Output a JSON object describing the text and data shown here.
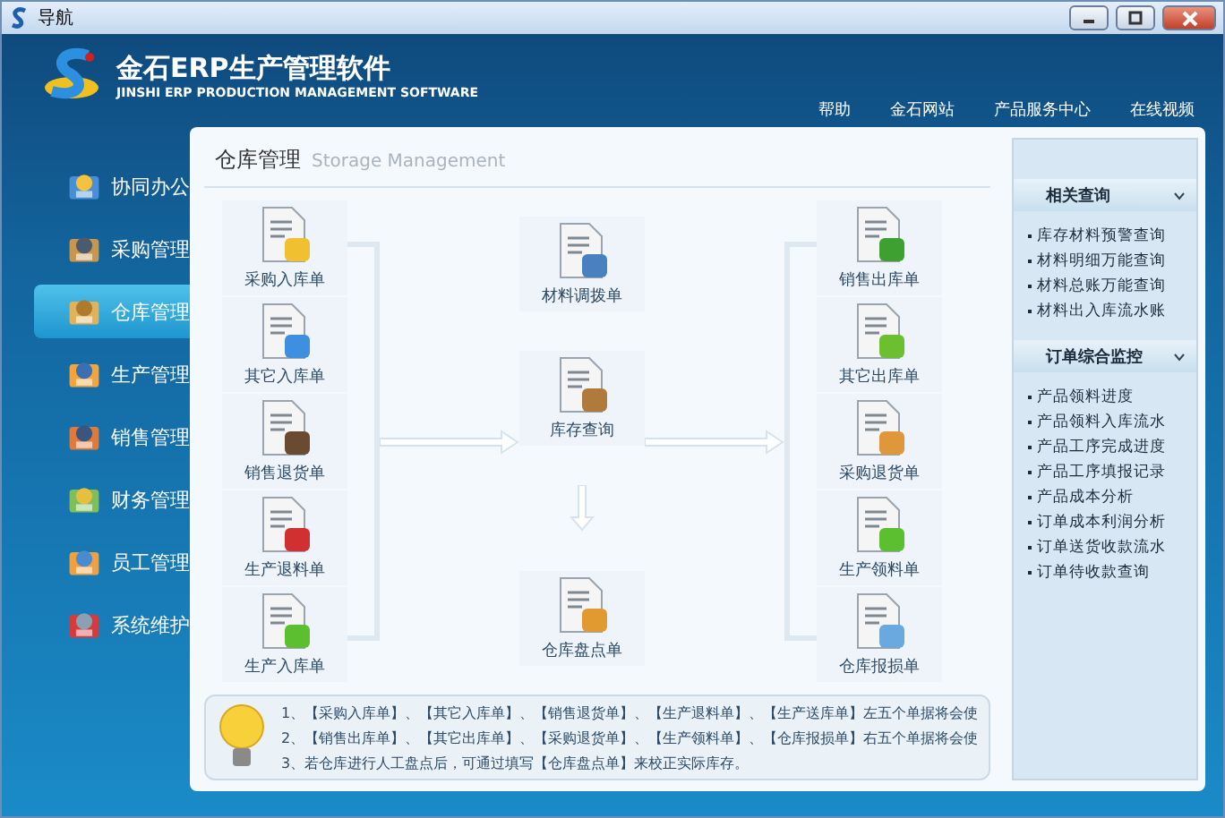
{
  "window": {
    "title": "导航"
  },
  "header": {
    "title": "金石ERP生产管理软件",
    "subtitle": "JINSHI ERP PRODUCTION MANAGEMENT SOFTWARE",
    "links": [
      "帮助",
      "金石网站",
      "产品服务中心",
      "在线视频"
    ]
  },
  "sidebar": {
    "items": [
      {
        "label": "协同办公",
        "kind": "office",
        "selected": false
      },
      {
        "label": "采购管理",
        "kind": "purchase",
        "selected": false
      },
      {
        "label": "仓库管理",
        "kind": "storage",
        "selected": true
      },
      {
        "label": "生产管理",
        "kind": "production",
        "selected": false
      },
      {
        "label": "销售管理",
        "kind": "sales",
        "selected": false
      },
      {
        "label": "财务管理",
        "kind": "finance",
        "selected": false
      },
      {
        "label": "员工管理",
        "kind": "staff",
        "selected": false
      },
      {
        "label": "系统维护",
        "kind": "system",
        "selected": false
      }
    ]
  },
  "panel": {
    "title": "仓库管理",
    "subtitle": "Storage Management",
    "inbound": [
      {
        "label": "采购入库单",
        "kind": "coins"
      },
      {
        "label": "其它入库单",
        "kind": "arrow-in"
      },
      {
        "label": "销售退货单",
        "kind": "person"
      },
      {
        "label": "生产退料单",
        "kind": "worker-back"
      },
      {
        "label": "生产入库单",
        "kind": "worker-in"
      }
    ],
    "center": [
      {
        "label": "材料调拨单",
        "kind": "table"
      },
      {
        "label": "库存查询",
        "kind": "search"
      },
      {
        "label": "仓库盘点单",
        "kind": "pencil"
      }
    ],
    "outbound": [
      {
        "label": "销售出库单",
        "kind": "yen"
      },
      {
        "label": "其它出库单",
        "kind": "arrow-out"
      },
      {
        "label": "采购退货单",
        "kind": "truck"
      },
      {
        "label": "生产领料单",
        "kind": "worker-in"
      },
      {
        "label": "仓库报损单",
        "kind": "block"
      }
    ],
    "tips": [
      "1、【采购入库单】、【其它入库单】、【销售退货单】、【生产退料单】、【生产送库单】左五个单据将会使",
      "2、【销售出库单】、【其它出库单】、【采购退货单】、【生产领料单】、【仓库报损单】右五个单据将会使",
      "3、若仓库进行人工盘点后，可通过填写【仓库盘点单】来校正实际库存。"
    ]
  },
  "related": [
    {
      "title": "相关查询",
      "expanded": true,
      "items": [
        "库存材料预警查询",
        "材料明细万能查询",
        "材料总账万能查询",
        "材料出入库流水账"
      ]
    },
    {
      "title": "订单综合监控",
      "expanded": true,
      "items": [
        "产品领料进度",
        "产品领料入库流水",
        "产品工序完成进度",
        "产品工序填报记录",
        "产品成本分析",
        "订单成本利润分析",
        "订单送货收款流水",
        "订单待收款查询"
      ]
    }
  ]
}
